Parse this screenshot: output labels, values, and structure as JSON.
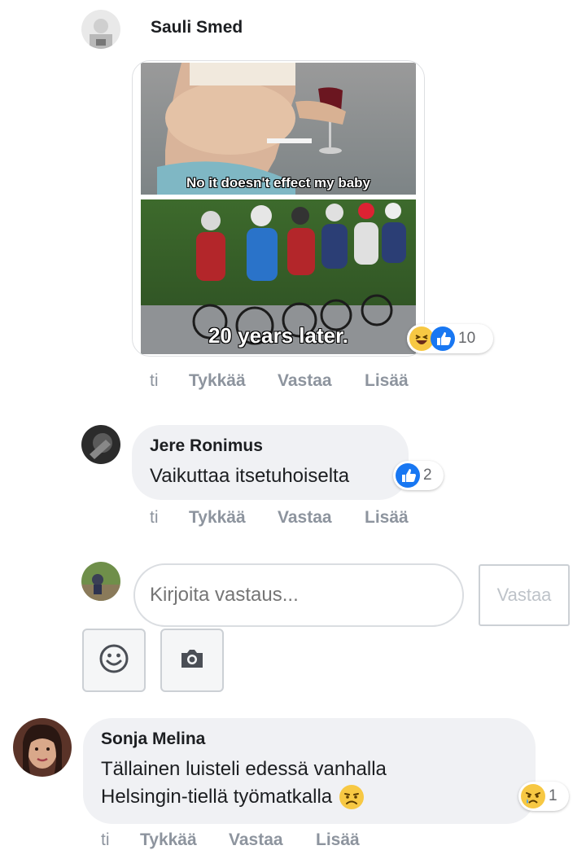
{
  "comments": [
    {
      "author": "Sauli Smed",
      "image": {
        "top_caption": "No it doesn't effect my baby",
        "bottom_caption": "20 years later."
      },
      "reactions": {
        "icons": [
          "haha-icon",
          "like-icon"
        ],
        "count": "10"
      },
      "actions": {
        "time": "ti",
        "like": "Tykkää",
        "reply": "Vastaa",
        "more": "Lisää"
      }
    },
    {
      "author": "Jere Ronimus",
      "text": "Vaikuttaa itsetuhoiselta",
      "reactions": {
        "icons": [
          "like-icon"
        ],
        "count": "2"
      },
      "actions": {
        "time": "ti",
        "like": "Tykkää",
        "reply": "Vastaa",
        "more": "Lisää"
      }
    },
    {
      "author": "Sonja Melina",
      "text_line1": "Tällainen luisteli edessä vanhalla",
      "text_line2": "Helsingin-tiellä työmatkalla",
      "inline_emoji": "worried-face-emoji",
      "reactions": {
        "icons": [
          "sad-icon"
        ],
        "count": "1"
      },
      "actions": {
        "time": "ti",
        "like": "Tykkää",
        "reply": "Vastaa",
        "more": "Lisää"
      }
    }
  ],
  "reply_box": {
    "placeholder": "Kirjoita vastaus...",
    "submit_label": "Vastaa",
    "tools": [
      "emoji-icon",
      "camera-icon"
    ]
  },
  "colors": {
    "bubble": "#f0f1f4",
    "action_text": "#8d949e",
    "like_blue": "#1877f2",
    "haha_yellow": "#f7c843"
  }
}
